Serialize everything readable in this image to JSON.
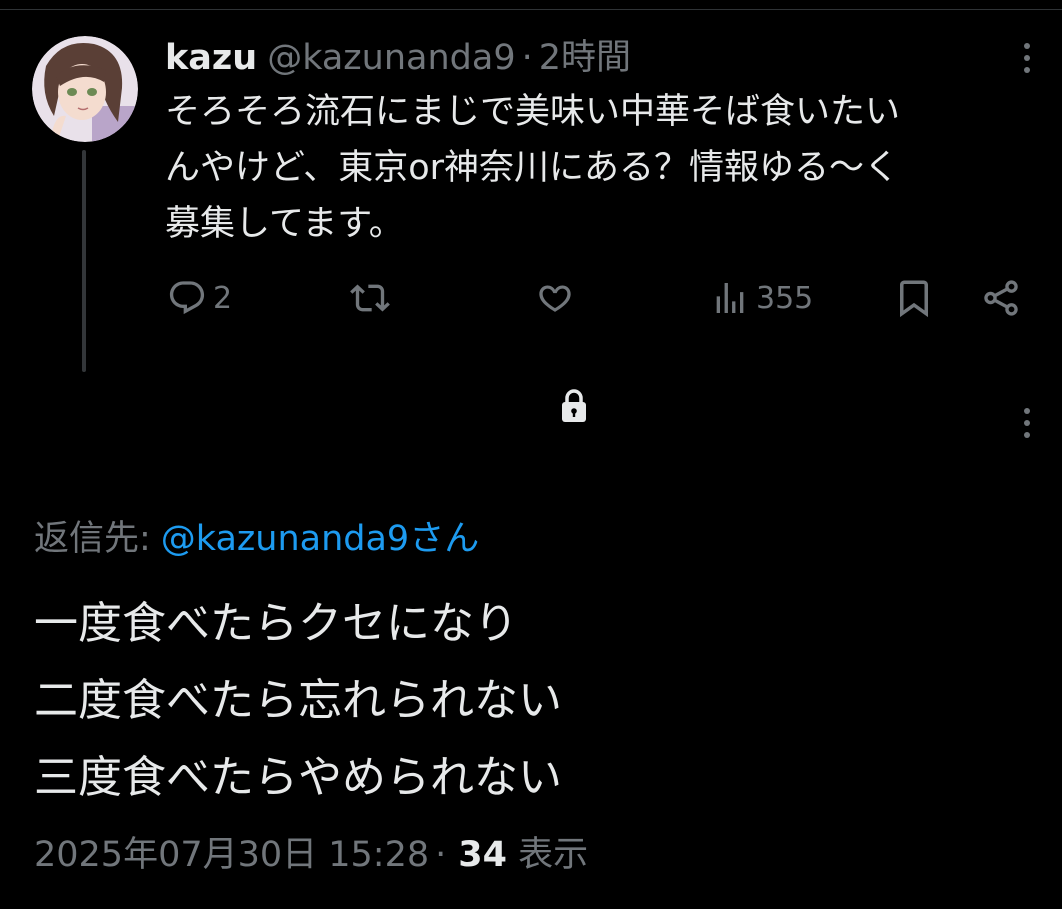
{
  "parent_tweet": {
    "display_name": "kazu",
    "handle": "@kazunanda9",
    "separator": "·",
    "time": "2時間",
    "text": "そろそろ流石にまじで美味い中華そば食いたい\nんやけど、東京or神奈川にある？情報ゆる〜く\n募集してます。",
    "avatar_icon": "avatar-anime-character",
    "actions": {
      "reply_count": "2",
      "retweet_count": "",
      "like_count": "",
      "view_count": "355"
    }
  },
  "reply": {
    "reply_to_label": "返信先:",
    "reply_to_mention": "@kazunanda9さん",
    "lines": [
      "一度食べたらクセになり",
      "二度食べたら忘れられない",
      "三度食べたらやめられない"
    ],
    "timestamp": "2025年07月30日 15:28",
    "separator": "·",
    "views_count": "34",
    "views_label": "表示"
  },
  "colors": {
    "background": "#000000",
    "text_primary": "#e7e9ea",
    "text_secondary": "#71767b",
    "link": "#1d9bf0",
    "thread_line": "#333639"
  }
}
